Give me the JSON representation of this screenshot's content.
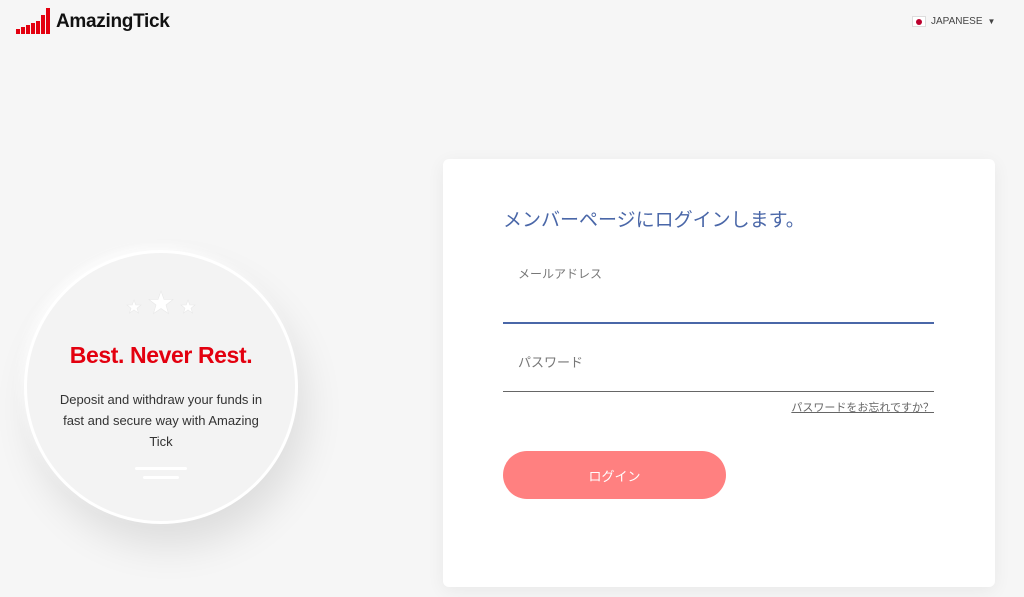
{
  "brand": {
    "name": "AmazingTick",
    "accent": "#e3000f"
  },
  "header": {
    "language": {
      "selected": "JAPANESE",
      "flag_icon": "japan-flag-icon"
    }
  },
  "promo": {
    "title": "Best. Never Rest.",
    "description": "Deposit and withdraw your funds in fast and secure way with Amazing Tick"
  },
  "login": {
    "title": "メンバーページにログインします。",
    "email_label": "メールアドレス",
    "email_value": "",
    "password_label": "パスワード",
    "password_value": "",
    "forgot_link": "パスワードをお忘れですか？",
    "submit_label": "ログイン",
    "colors": {
      "title": "#4a67a8",
      "button": "#ff8080"
    }
  }
}
